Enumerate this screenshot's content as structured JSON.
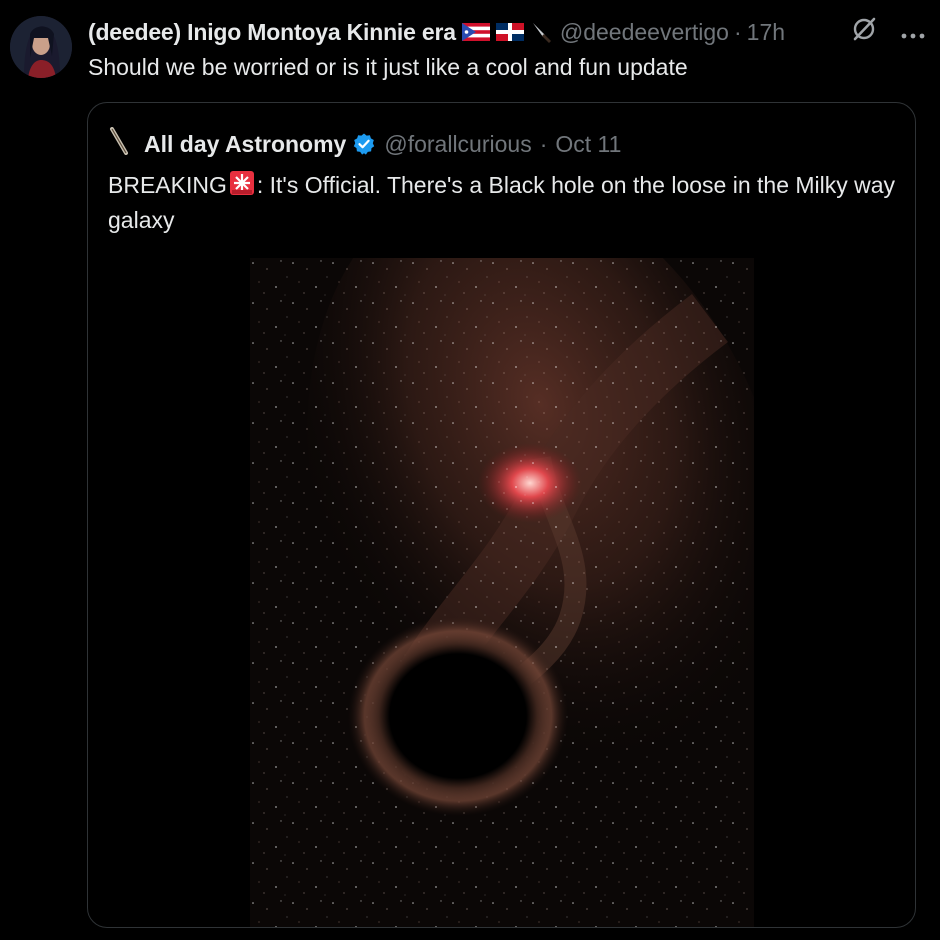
{
  "tweet": {
    "author_name": "(deedee) Inigo Montoya Kinnie era",
    "author_emojis": [
      "puerto-rico-flag",
      "dominican-republic-flag",
      "knife"
    ],
    "handle": "@deedeevertigo",
    "separator": "·",
    "time": "17h",
    "text": "Should we be worried or is it just like a cool and fun update"
  },
  "quoted": {
    "name": "All day Astronomy",
    "verified": true,
    "handle": "@forallcurious",
    "separator": "·",
    "date": "Oct 11",
    "text_before": "BREAKING",
    "text_after": ": It's Official. There's a Black hole on the loose in the Milky way galaxy",
    "media": "black-hole-milky-way-image"
  },
  "icons": [
    "grok-icon",
    "more-icon",
    "knife-icon",
    "siren-icon",
    "verified-badge-icon"
  ],
  "colors": {
    "background": "#000000",
    "text": "#e7e9ea",
    "muted": "#71767b",
    "border": "#2f3336",
    "verified": "#1d9bf0"
  }
}
